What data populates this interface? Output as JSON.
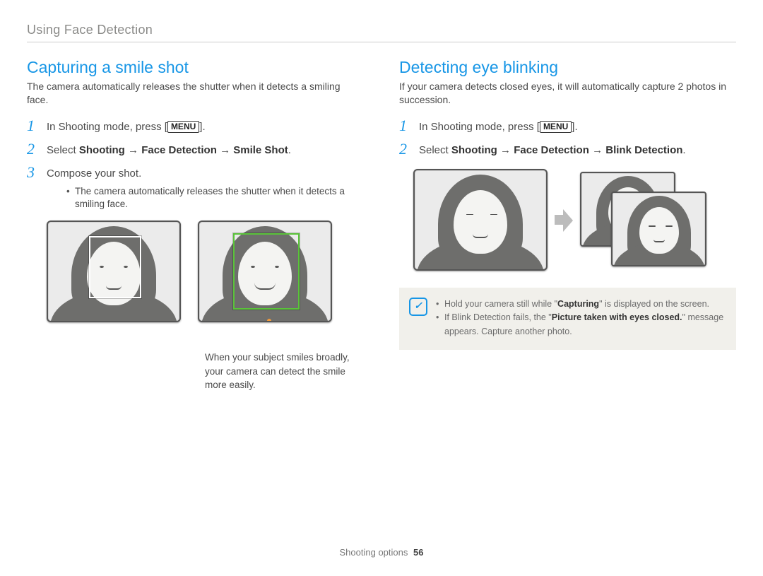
{
  "page_header": "Using Face Detection",
  "footer": {
    "section": "Shooting options",
    "page": "56"
  },
  "menu_label": "MENU",
  "note_icon_glyph": "✓",
  "left": {
    "title": "Capturing a smile shot",
    "intro": "The camera automatically releases the shutter when it detects a smiling face.",
    "steps": {
      "s1_prefix": "In Shooting mode, press [",
      "s1_suffix": "].",
      "s2_prefix": "Select ",
      "s2_b1": "Shooting",
      "s2_b2": "Face Detection",
      "s2_b3": "Smile Shot",
      "s2_suffix": ".",
      "s3": "Compose your shot.",
      "s3_bullet": "The camera automatically releases the shutter when it detects a smiling face."
    },
    "caption": "When your subject smiles broadly, your camera can detect the smile more easily."
  },
  "right": {
    "title": "Detecting eye blinking",
    "intro": "If your camera detects closed eyes, it will automatically capture 2 photos in succession.",
    "steps": {
      "s1_prefix": "In Shooting mode, press [",
      "s1_suffix": "].",
      "s2_prefix": "Select ",
      "s2_b1": "Shooting",
      "s2_b2": "Face Detection",
      "s2_b3": "Blink Detection",
      "s2_suffix": "."
    },
    "notes": {
      "n1_a": "Hold your camera still while \"",
      "n1_bold": "Capturing",
      "n1_b": "\" is displayed on the screen.",
      "n2_a": "If Blink Detection fails, the \"",
      "n2_bold": "Picture taken with eyes closed.",
      "n2_b": "\" message appears. Capture another photo."
    }
  }
}
